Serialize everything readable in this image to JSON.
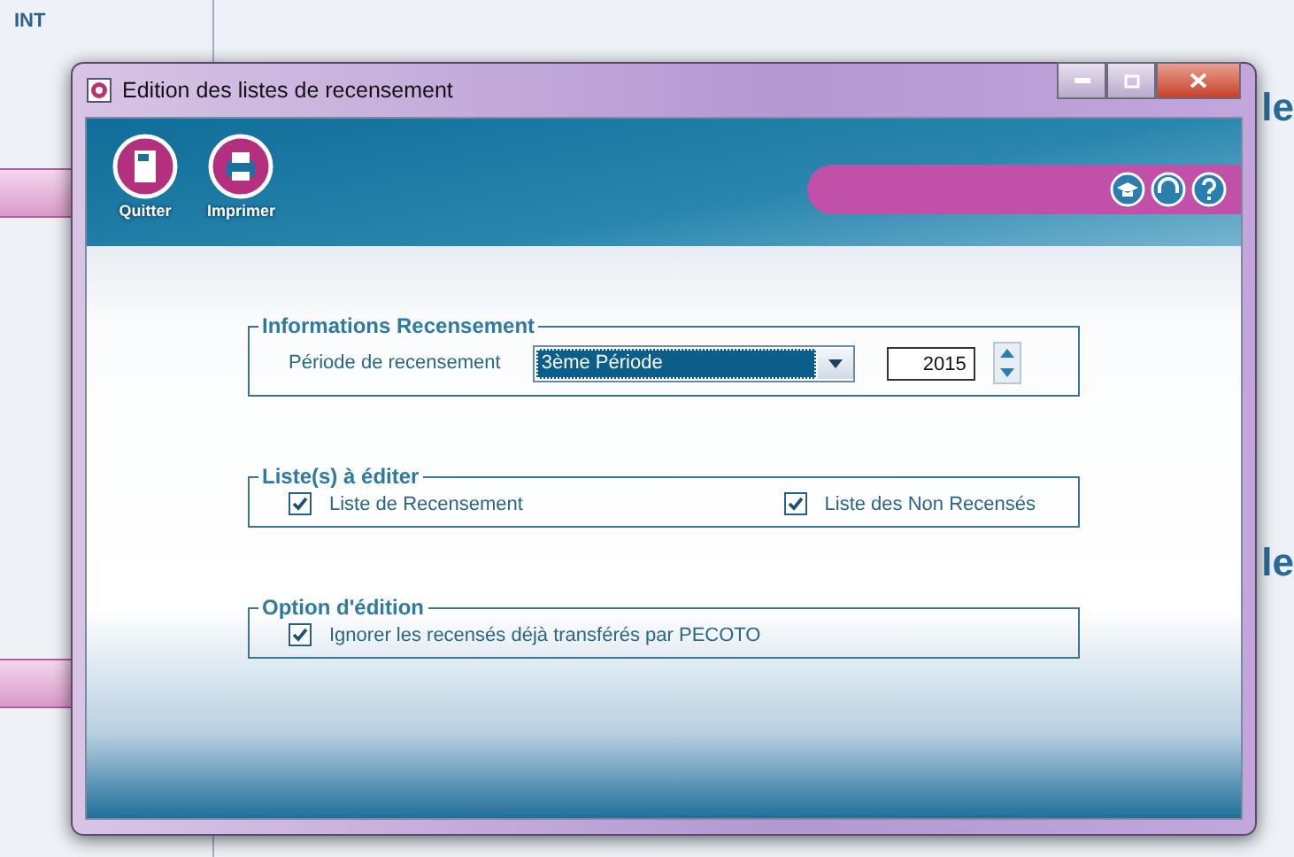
{
  "background": {
    "corner_label": "INT",
    "edge_labels": [
      "le",
      "le"
    ]
  },
  "window": {
    "title": "Edition des listes de recensement"
  },
  "toolbar": {
    "buttons": [
      {
        "kind": "exit",
        "label": "Quitter"
      },
      {
        "kind": "print",
        "label": "Imprimer"
      }
    ]
  },
  "info_group": {
    "title": "Informations Recensement",
    "period_label": "Période de recensement",
    "period_value": "3ème Période",
    "year": "2015"
  },
  "lists_group": {
    "title": "Liste(s) à éditer",
    "items": [
      {
        "label": "Liste de Recensement",
        "checked": true
      },
      {
        "label": "Liste des Non Recensés",
        "checked": true
      }
    ]
  },
  "option_group": {
    "title": "Option d'édition",
    "items": [
      {
        "label": "Ignorer les recensés déjà transférés par PECOTO",
        "checked": true
      }
    ]
  }
}
